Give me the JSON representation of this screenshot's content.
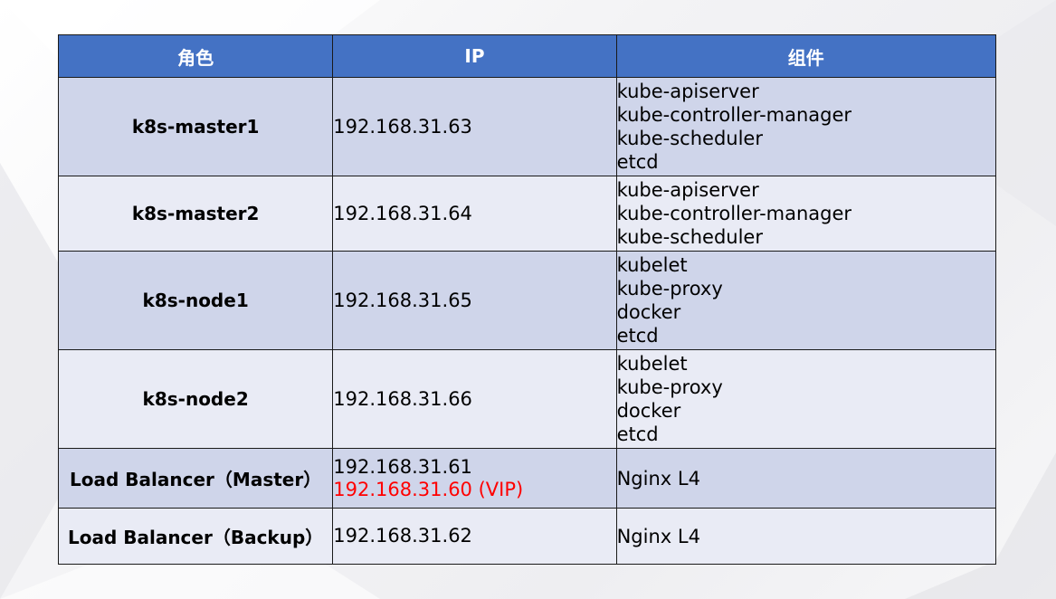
{
  "table": {
    "headers": [
      "角色",
      "IP",
      "组件"
    ],
    "rows": [
      {
        "role": "k8s-master1",
        "ip": [
          "192.168.31.63"
        ],
        "components": [
          "kube-apiserver",
          "kube-controller-manager",
          "kube-scheduler",
          "etcd"
        ]
      },
      {
        "role": "k8s-master2",
        "ip": [
          "192.168.31.64"
        ],
        "components": [
          "kube-apiserver",
          "kube-controller-manager",
          "kube-scheduler"
        ]
      },
      {
        "role": "k8s-node1",
        "ip": [
          "192.168.31.65"
        ],
        "components": [
          "kubelet",
          "kube-proxy",
          "docker",
          "etcd"
        ]
      },
      {
        "role": "k8s-node2",
        "ip": [
          "192.168.31.66"
        ],
        "components": [
          "kubelet",
          "kube-proxy",
          "docker",
          "etcd"
        ]
      },
      {
        "role": "Load Balancer（Master）",
        "ip": [
          "192.168.31.61",
          "192.168.31.60 (VIP)"
        ],
        "components": [
          "Nginx L4"
        ]
      },
      {
        "role": "Load Balancer（Backup）",
        "ip": [
          "192.168.31.62"
        ],
        "components": [
          "Nginx L4"
        ]
      }
    ]
  },
  "colors": {
    "header_bg": "#4472c4",
    "row_odd_bg": "#cfd5ea",
    "row_even_bg": "#e9ebf5",
    "vip_text": "#ff0000"
  }
}
